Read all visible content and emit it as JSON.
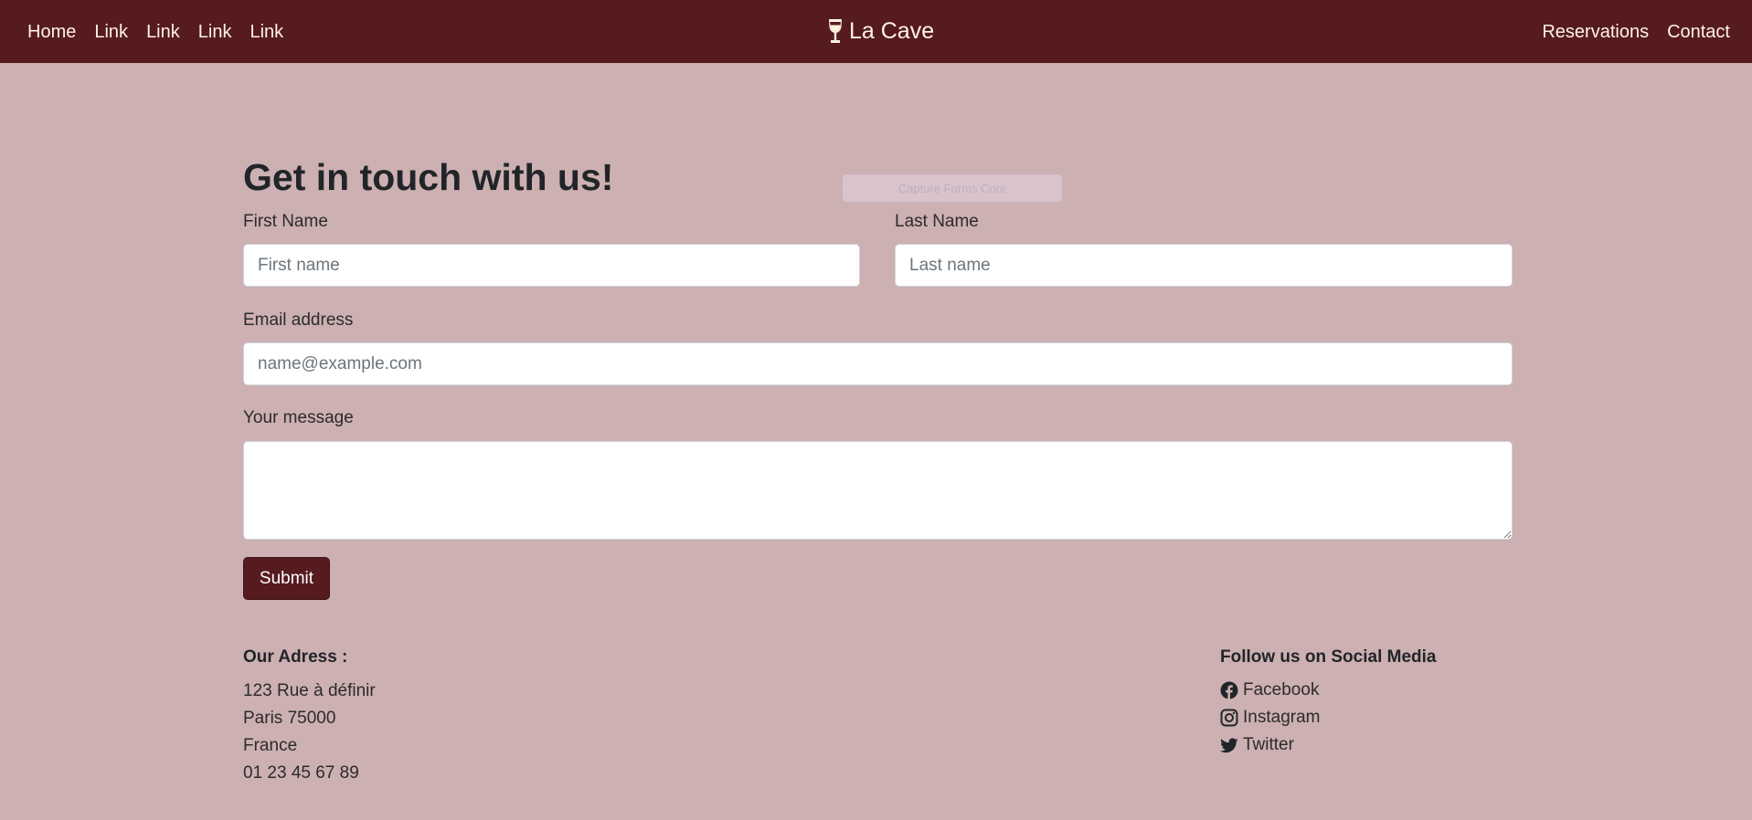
{
  "navbar": {
    "left_links": [
      "Home",
      "Link",
      "Link",
      "Link",
      "Link"
    ],
    "brand": "La Cave",
    "brand_icon": "wine-glass-icon",
    "right_links": [
      "Reservations",
      "Contact"
    ]
  },
  "overlay": {
    "text": "Capture Forms Core"
  },
  "form": {
    "heading": "Get in touch with us!",
    "first_name_label": "First Name",
    "first_name_placeholder": "First name",
    "last_name_label": "Last Name",
    "last_name_placeholder": "Last name",
    "email_label": "Email address",
    "email_placeholder": "name@example.com",
    "message_label": "Your message",
    "submit_label": "Submit"
  },
  "footer": {
    "address_title": "Our Adress :",
    "address_lines": [
      "123 Rue à définir",
      "Paris 75000",
      "France",
      "01 23 45 67 89"
    ],
    "social_title": "Follow us on Social Media",
    "social_links": [
      {
        "label": "Facebook",
        "icon": "facebook-icon"
      },
      {
        "label": "Instagram",
        "icon": "instagram-icon"
      },
      {
        "label": "Twitter",
        "icon": "twitter-icon"
      }
    ]
  },
  "colors": {
    "navbar_bg": "#561b1f",
    "page_bg": "#cdb0b2",
    "nav_text": "#fff4e0",
    "button_bg": "#561b1f"
  }
}
